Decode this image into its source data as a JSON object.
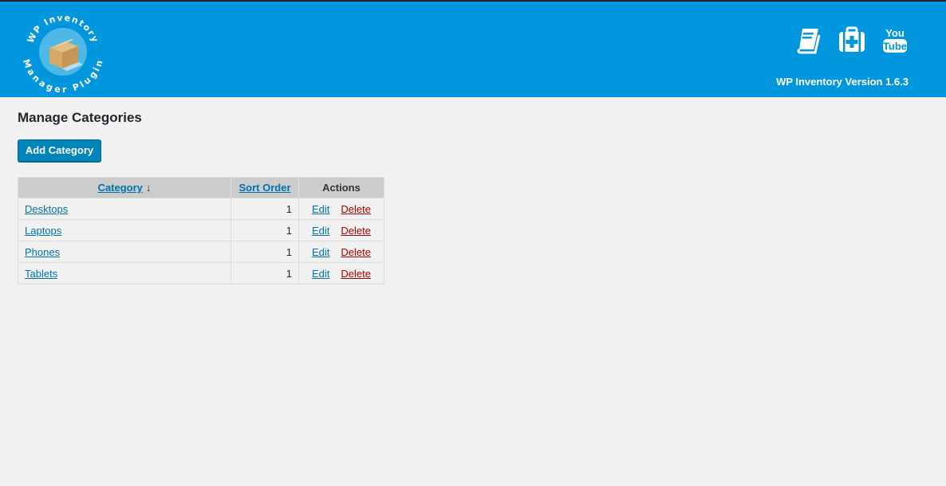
{
  "header": {
    "logo_text_top": "WP Inventory",
    "logo_text_bottom": "Manager Plugin",
    "version": "WP Inventory Version 1.6.3",
    "icons": [
      "book-icon",
      "first-aid-kit-icon",
      "youtube-icon"
    ],
    "youtube_top": "You",
    "youtube_bottom": "Tube",
    "brand_color": "#0096dd"
  },
  "page": {
    "title": "Manage Categories",
    "add_button": "Add Category"
  },
  "table": {
    "headers": {
      "category": "Category",
      "sort_arrow": "↓",
      "sort_order": "Sort Order",
      "actions": "Actions"
    },
    "rows": [
      {
        "name": "Desktops",
        "sort_order": "1",
        "edit": "Edit",
        "delete": "Delete"
      },
      {
        "name": "Laptops",
        "sort_order": "1",
        "edit": "Edit",
        "delete": "Delete"
      },
      {
        "name": "Phones",
        "sort_order": "1",
        "edit": "Edit",
        "delete": "Delete"
      },
      {
        "name": "Tablets",
        "sort_order": "1",
        "edit": "Edit",
        "delete": "Delete"
      }
    ]
  }
}
